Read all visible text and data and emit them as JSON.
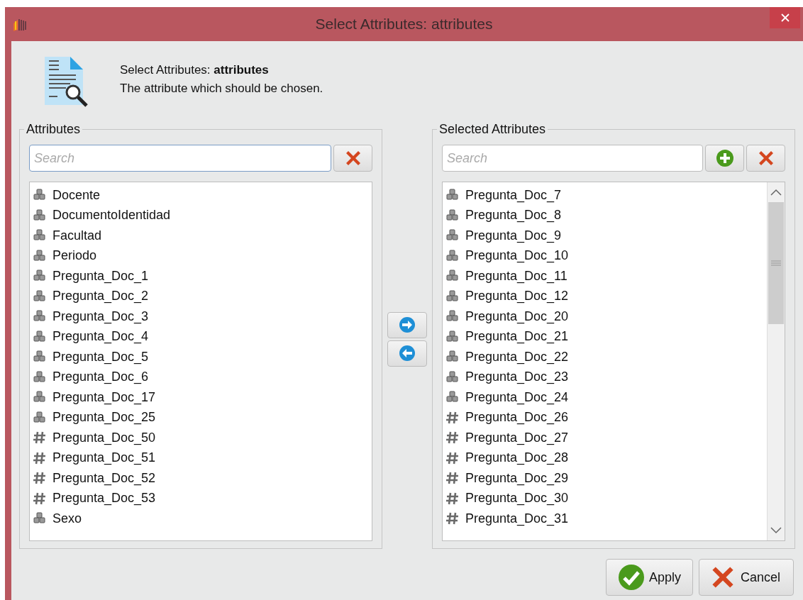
{
  "window": {
    "title": "Select Attributes: attributes"
  },
  "header": {
    "title": "Select Attributes: **attributes**",
    "description": "The attribute which should be chosen."
  },
  "panels": [
    {
      "title": "Attributes",
      "search": {
        "placeholder": "Search",
        "focused": true
      },
      "add_button": false,
      "scrollbar": false,
      "items": [
        {
          "label": "Docente",
          "kind": "nominal"
        },
        {
          "label": "DocumentoIdentidad",
          "kind": "nominal"
        },
        {
          "label": "Facultad",
          "kind": "nominal"
        },
        {
          "label": "Periodo",
          "kind": "nominal"
        },
        {
          "label": "Pregunta_Doc_1",
          "kind": "nominal"
        },
        {
          "label": "Pregunta_Doc_2",
          "kind": "nominal"
        },
        {
          "label": "Pregunta_Doc_3",
          "kind": "nominal"
        },
        {
          "label": "Pregunta_Doc_4",
          "kind": "nominal"
        },
        {
          "label": "Pregunta_Doc_5",
          "kind": "nominal"
        },
        {
          "label": "Pregunta_Doc_6",
          "kind": "nominal"
        },
        {
          "label": "Pregunta_Doc_17",
          "kind": "nominal"
        },
        {
          "label": "Pregunta_Doc_25",
          "kind": "nominal"
        },
        {
          "label": "Pregunta_Doc_50",
          "kind": "numeric"
        },
        {
          "label": "Pregunta_Doc_51",
          "kind": "numeric"
        },
        {
          "label": "Pregunta_Doc_52",
          "kind": "numeric"
        },
        {
          "label": "Pregunta_Doc_53",
          "kind": "numeric"
        },
        {
          "label": "Sexo",
          "kind": "nominal"
        }
      ]
    },
    {
      "title": "Selected Attributes",
      "search": {
        "placeholder": "Search",
        "focused": false
      },
      "add_button": true,
      "scrollbar": true,
      "items": [
        {
          "label": "Pregunta_Doc_7",
          "kind": "nominal"
        },
        {
          "label": "Pregunta_Doc_8",
          "kind": "nominal"
        },
        {
          "label": "Pregunta_Doc_9",
          "kind": "nominal"
        },
        {
          "label": "Pregunta_Doc_10",
          "kind": "nominal"
        },
        {
          "label": "Pregunta_Doc_11",
          "kind": "nominal"
        },
        {
          "label": "Pregunta_Doc_12",
          "kind": "nominal"
        },
        {
          "label": "Pregunta_Doc_20",
          "kind": "nominal"
        },
        {
          "label": "Pregunta_Doc_21",
          "kind": "nominal"
        },
        {
          "label": "Pregunta_Doc_22",
          "kind": "nominal"
        },
        {
          "label": "Pregunta_Doc_23",
          "kind": "nominal"
        },
        {
          "label": "Pregunta_Doc_24",
          "kind": "nominal"
        },
        {
          "label": "Pregunta_Doc_26",
          "kind": "numeric"
        },
        {
          "label": "Pregunta_Doc_27",
          "kind": "numeric"
        },
        {
          "label": "Pregunta_Doc_28",
          "kind": "numeric"
        },
        {
          "label": "Pregunta_Doc_29",
          "kind": "numeric"
        },
        {
          "label": "Pregunta_Doc_30",
          "kind": "numeric"
        },
        {
          "label": "Pregunta_Doc_31",
          "kind": "numeric"
        }
      ]
    }
  ],
  "buttons": [
    {
      "label": "Apply",
      "kind": "apply"
    },
    {
      "label": "Cancel",
      "kind": "cancel"
    }
  ]
}
